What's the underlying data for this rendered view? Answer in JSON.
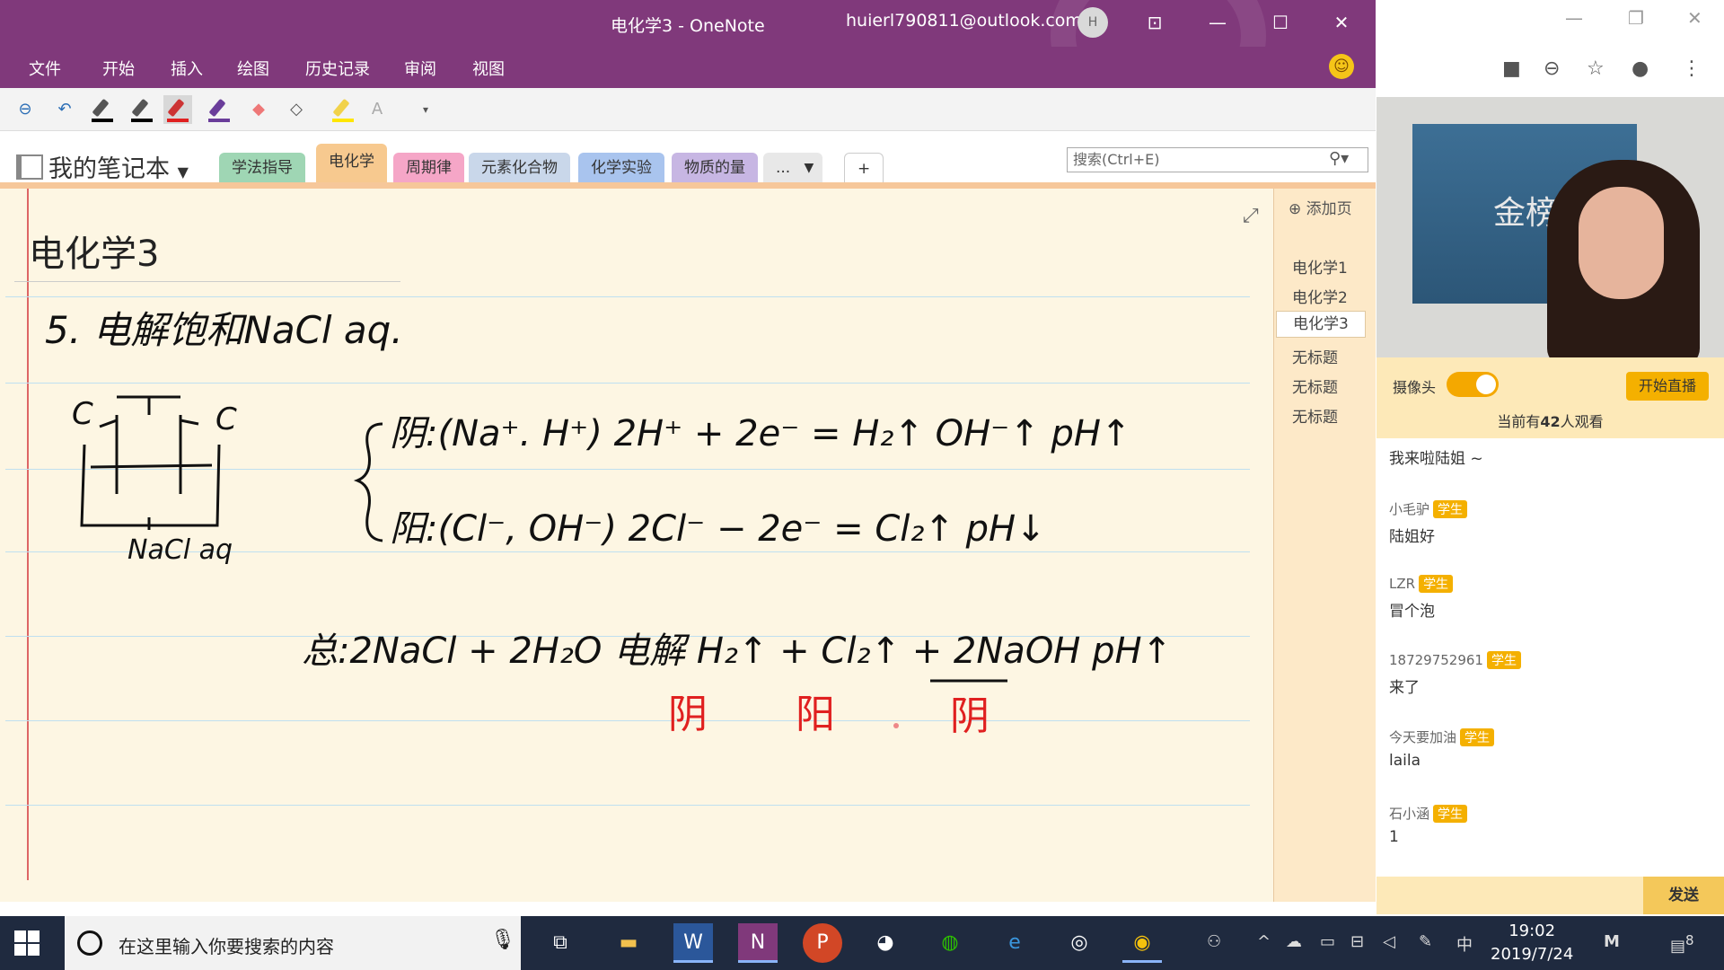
{
  "onenote": {
    "title": "电化学3  -  OneNote",
    "account": "huierl790811@outlook.com",
    "avatar_initial": "H",
    "menu": [
      "文件",
      "开始",
      "插入",
      "绘图",
      "历史记录",
      "审阅",
      "视图"
    ],
    "notebook": "我的笔记本",
    "tabs": [
      {
        "label": "学法指导",
        "color": "#9fd6b4"
      },
      {
        "label": "电化学",
        "color": "#f7c98f"
      },
      {
        "label": "周期律",
        "color": "#f5a6c7"
      },
      {
        "label": "元素化合物",
        "color": "#c9d7ea"
      },
      {
        "label": "化学实验",
        "color": "#a9c4ee"
      },
      {
        "label": "物质的量",
        "color": "#c7b6e3"
      },
      {
        "label": "...",
        "color": "#e8e8e8"
      }
    ],
    "add_tab": "+",
    "search_placeholder": "搜索(Ctrl+E)",
    "page_title": "电化学3",
    "add_page": "添加页",
    "pages": [
      "电化学1",
      "电化学2",
      "电化学3",
      "无标题",
      "无标题",
      "无标题"
    ],
    "active_page_index": 2,
    "active_tab_index": 1
  },
  "ink": {
    "line1": "5. 电解饱和NaCl aq.",
    "cell_labels": [
      "C",
      "C"
    ],
    "cell_solution": "NaCl aq",
    "cathode_line": "阴:(Na⁺. H⁺)   2H⁺ + 2e⁻ = H₂↑   OH⁻↑   pH↑",
    "anode_line": "阳:(Cl⁻, OH⁻)   2Cl⁻ − 2e⁻ = Cl₂↑   pH↓",
    "total_line": "总:2NaCl + 2H₂O 电解 H₂↑ + Cl₂↑ + 2NaOH   pH↑",
    "red_labels": [
      "阴",
      "阳",
      "阴"
    ]
  },
  "live": {
    "banner_text": "金榜",
    "camera_label": "摄像头",
    "start_live": "开始直播",
    "viewer_prefix": "当前有",
    "viewer_count": "42",
    "viewer_suffix": "人观看",
    "first_message": "我来啦陆姐 ~",
    "messages": [
      {
        "name": "小毛驴",
        "badge": "学生",
        "text": "陆姐好"
      },
      {
        "name": "LZR",
        "badge": "学生",
        "text": "冒个泡"
      },
      {
        "name": "18729752961",
        "badge": "学生",
        "text": "来了"
      },
      {
        "name": "今天要加油",
        "badge": "学生",
        "text": "laila"
      },
      {
        "name": "石小涵",
        "badge": "学生",
        "text": "1"
      }
    ],
    "send": "发送"
  },
  "taskbar": {
    "search_placeholder": "在这里输入你要搜索的内容",
    "time": "19:02",
    "date": "2019/7/24",
    "ime": "中",
    "notifications": "8"
  }
}
